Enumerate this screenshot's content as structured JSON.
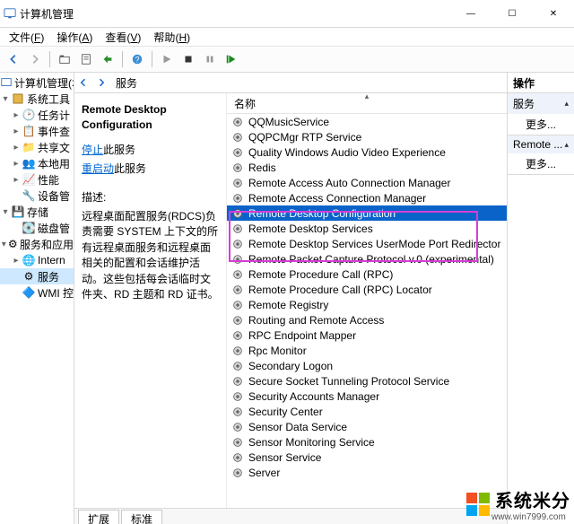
{
  "window": {
    "title": "计算机管理"
  },
  "menu": {
    "file": {
      "label": "文件",
      "hotkey": "F"
    },
    "action": {
      "label": "操作",
      "hotkey": "A"
    },
    "view": {
      "label": "查看",
      "hotkey": "V"
    },
    "help": {
      "label": "帮助",
      "hotkey": "H"
    }
  },
  "nav": {
    "root": "计算机管理(本",
    "system_tools": "系统工具",
    "task": "任务计",
    "event": "事件查",
    "shared": "共享文",
    "local": "本地用",
    "perf": "性能",
    "device": "设备管",
    "storage": "存储",
    "disk": "磁盘管",
    "services_apps": "服务和应用",
    "internet": "Intern",
    "services": "服务",
    "wmi": "WMI 控"
  },
  "center": {
    "header": "服务",
    "svc_name": "Remote Desktop Configuration",
    "stop_link": "停止",
    "stop_suffix": "此服务",
    "restart_link": "重启动",
    "restart_suffix": "此服务",
    "desc_label": "描述:",
    "desc_body": "远程桌面配置服务(RDCS)负责需要 SYSTEM 上下文的所有远程桌面服务和远程桌面相关的配置和会话维护活动。这些包括每会话临时文件夹、RD 主题和 RD 证书。",
    "col_name": "名称",
    "tabs": {
      "ext": "扩展",
      "std": "标准"
    }
  },
  "services": [
    "QQMusicService",
    "QQPCMgr RTP Service",
    "Quality Windows Audio Video Experience",
    "Redis",
    "Remote Access Auto Connection Manager",
    "Remote Access Connection Manager",
    "Remote Desktop Configuration",
    "Remote Desktop Services",
    "Remote Desktop Services UserMode Port Redirector",
    "Remote Packet Capture Protocol v.0 (experimental)",
    "Remote Procedure Call (RPC)",
    "Remote Procedure Call (RPC) Locator",
    "Remote Registry",
    "Routing and Remote Access",
    "RPC Endpoint Mapper",
    "Rpc Monitor",
    "Secondary Logon",
    "Secure Socket Tunneling Protocol Service",
    "Security Accounts Manager",
    "Security Center",
    "Sensor Data Service",
    "Sensor Monitoring Service",
    "Sensor Service",
    "Server"
  ],
  "selected_service_index": 6,
  "actions": {
    "header": "操作",
    "section1_title": "服务",
    "section2_title": "Remote ...",
    "more": "更多..."
  },
  "watermark": {
    "text": "系统米分",
    "sub": "www.win7999.com"
  }
}
